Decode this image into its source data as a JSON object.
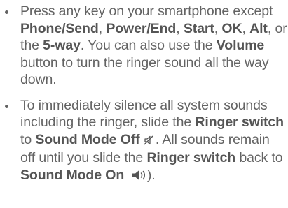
{
  "bullets": [
    {
      "p1": "Press any key on your smartphone except ",
      "b1": "Phone/Send",
      "p2": ", ",
      "b2": "Power/End",
      "p3": ", ",
      "b3": "Start",
      "p4": ", ",
      "b4": "OK",
      "p5": ", ",
      "b5": "Alt",
      "p6": ", or the ",
      "b6": "5-way",
      "p7": ". You can also use the ",
      "b7": "Volume",
      "p8": " button to turn the ringer sound all the way down."
    },
    {
      "p1": "To immediately silence all system sounds including the ringer, slide the ",
      "b1": "Ringer switch",
      "p2": " to ",
      "b2": "Sound Mode Off",
      "icon1": "muted-speaker-icon",
      "p3": ". All sounds remain off until you slide the ",
      "b3": "Ringer switch",
      "p4": " back to ",
      "b4": "Sound Mode On",
      "icon2": "speaker-on-icon",
      "p5": ")."
    }
  ]
}
